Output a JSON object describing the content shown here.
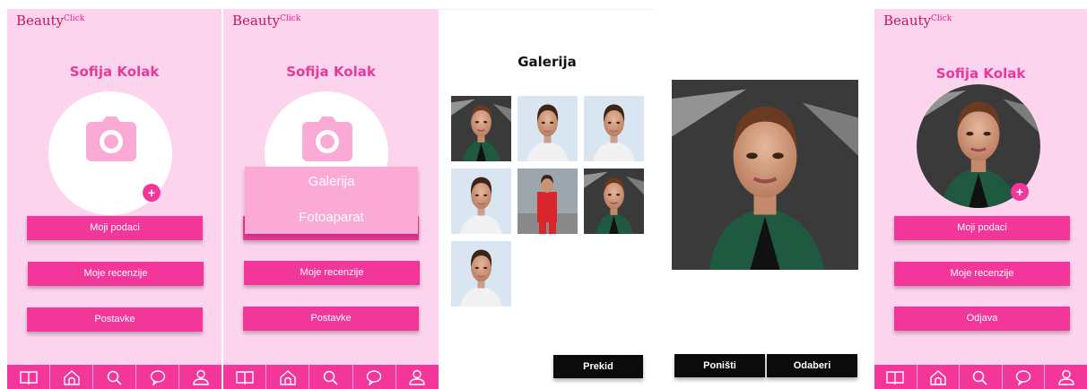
{
  "app": {
    "logo_text": "Beauty",
    "logo_suffix": "Click"
  },
  "screen1": {
    "user_name": "Sofija Kolak",
    "buttons": [
      "Moji podaci",
      "Moje recenzije",
      "Postavke"
    ]
  },
  "screen2": {
    "user_name": "Sofija Kolak",
    "popup_options": [
      "Galerija",
      "Fotoaparat"
    ],
    "buttons": [
      "Moje recenzije",
      "Postavke"
    ]
  },
  "screen3": {
    "title": "Galerija",
    "cancel_label": "Prekid"
  },
  "screen4": {
    "reset_label": "Poništi",
    "select_label": "Odaberi"
  },
  "screen5": {
    "user_name": "Sofija Kolak",
    "buttons": [
      "Moji podaci",
      "Moje recenzije",
      "Odjava"
    ]
  },
  "nav_items": [
    "book-icon",
    "home-icon",
    "search-icon",
    "chat-icon",
    "profile-icon"
  ],
  "colors": {
    "accent": "#f2369a",
    "background": "#fdd4ee",
    "popup": "#fbaad6",
    "dark_button": "#0b0b0b"
  }
}
